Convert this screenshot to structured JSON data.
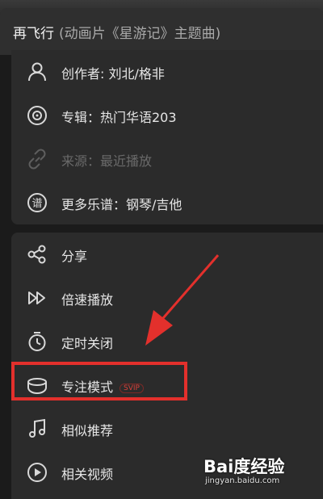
{
  "header": {
    "title": "再飞行",
    "subtitle": "(动画片《星游记》主题曲)"
  },
  "info": [
    {
      "icon": "person-icon",
      "label": "创作者: 刘北/格非",
      "enabled": true
    },
    {
      "icon": "disc-icon",
      "label": "专辑：热门华语203",
      "enabled": true
    },
    {
      "icon": "link-icon",
      "label": "来源：最近播放",
      "enabled": false
    },
    {
      "icon": "score-icon",
      "label": "更多乐谱：钢琴/吉他",
      "enabled": true
    }
  ],
  "actions": [
    {
      "icon": "share-icon",
      "label": "分享"
    },
    {
      "icon": "speed-icon",
      "label": "倍速播放"
    },
    {
      "icon": "timer-icon",
      "label": "定时关闭"
    },
    {
      "icon": "focus-mode-icon",
      "label": "专注模式",
      "badge": "SVIP"
    },
    {
      "icon": "music-note-icon",
      "label": "相似推荐"
    },
    {
      "icon": "video-icon",
      "label": "相关视频"
    }
  ],
  "watermark": {
    "logo": "Bai度经验",
    "url": "jingyan.baidu.com"
  },
  "colors": {
    "highlight": "#e3302c",
    "panel": "#2b2b2b",
    "background": "#1b1b1b"
  }
}
